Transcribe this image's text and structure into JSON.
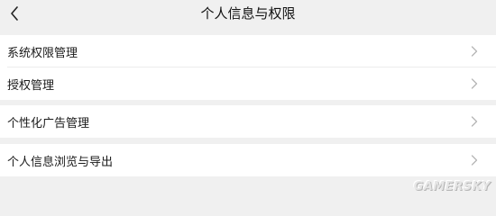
{
  "header": {
    "title": "个人信息与权限",
    "back_icon": "chevron-left-icon"
  },
  "groups": [
    {
      "items": [
        {
          "label": "系统权限管理"
        },
        {
          "label": "授权管理"
        }
      ]
    },
    {
      "items": [
        {
          "label": "个性化广告管理"
        }
      ]
    },
    {
      "items": [
        {
          "label": "个人信息浏览与导出"
        }
      ]
    }
  ],
  "item_icon": "chevron-right-icon",
  "watermark": "GAMERSKY",
  "colors": {
    "background": "#f0f0f0",
    "card": "#ffffff",
    "text": "#1a1a1a",
    "chevron": "#b5b5b5"
  }
}
